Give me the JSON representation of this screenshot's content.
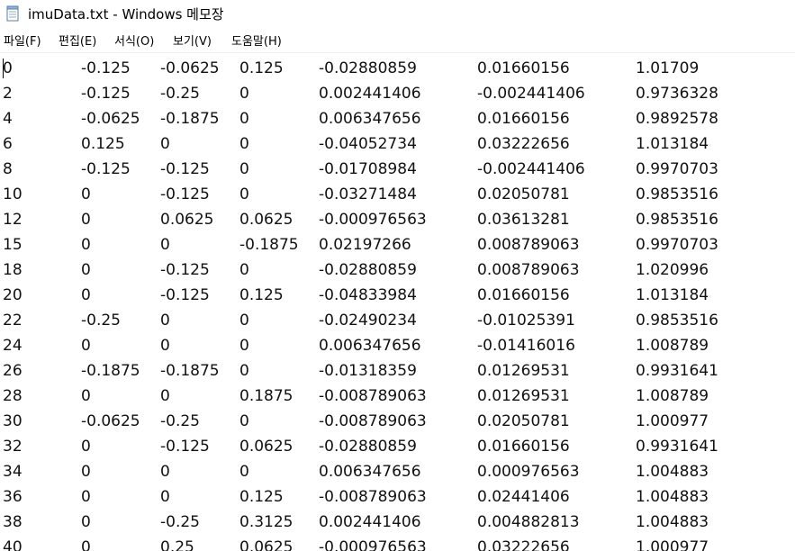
{
  "window": {
    "title": "imuData.txt - Windows 메모장",
    "icon": "notepad-icon"
  },
  "menu": {
    "items": [
      {
        "label": "파일(F)"
      },
      {
        "label": "편집(E)"
      },
      {
        "label": "서식(O)"
      },
      {
        "label": "보기(V)"
      },
      {
        "label": "도움말(H)"
      }
    ]
  },
  "document": {
    "rows": [
      [
        "0",
        "-0.125",
        "-0.0625",
        "0.125",
        "-0.02880859",
        "0.01660156",
        "1.01709"
      ],
      [
        "2",
        "-0.125",
        "-0.25",
        "0",
        "0.002441406",
        "-0.002441406",
        "0.9736328"
      ],
      [
        "4",
        "-0.0625",
        "-0.1875",
        "0",
        "0.006347656",
        "0.01660156",
        "0.9892578"
      ],
      [
        "6",
        "0.125",
        "0",
        "0",
        "-0.04052734",
        "0.03222656",
        "1.013184"
      ],
      [
        "8",
        "-0.125",
        "-0.125",
        "0",
        "-0.01708984",
        "-0.002441406",
        "0.9970703"
      ],
      [
        "10",
        "0",
        "-0.125",
        "0",
        "-0.03271484",
        "0.02050781",
        "0.9853516"
      ],
      [
        "12",
        "0",
        "0.0625",
        "0.0625",
        "-0.000976563",
        "0.03613281",
        "0.9853516"
      ],
      [
        "15",
        "0",
        "0",
        "-0.1875",
        "0.02197266",
        "0.008789063",
        "0.9970703"
      ],
      [
        "18",
        "0",
        "-0.125",
        "0",
        "-0.02880859",
        "0.008789063",
        "1.020996"
      ],
      [
        "20",
        "0",
        "-0.125",
        "0.125",
        "-0.04833984",
        "0.01660156",
        "1.013184"
      ],
      [
        "22",
        "-0.25",
        "0",
        "0",
        "-0.02490234",
        "-0.01025391",
        "0.9853516"
      ],
      [
        "24",
        "0",
        "0",
        "0",
        "0.006347656",
        "-0.01416016",
        "1.008789"
      ],
      [
        "26",
        "-0.1875",
        "-0.1875",
        "0",
        "-0.01318359",
        "0.01269531",
        "0.9931641"
      ],
      [
        "28",
        "0",
        "0",
        "0.1875",
        "-0.008789063",
        "0.01269531",
        "1.008789"
      ],
      [
        "30",
        "-0.0625",
        "-0.25",
        "0",
        "-0.008789063",
        "0.02050781",
        "1.000977"
      ],
      [
        "32",
        "0",
        "-0.125",
        "0.0625",
        "-0.02880859",
        "0.01660156",
        "0.9931641"
      ],
      [
        "34",
        "0",
        "0",
        "0",
        "0.006347656",
        "0.000976563",
        "1.004883"
      ],
      [
        "36",
        "0",
        "0",
        "0.125",
        "-0.008789063",
        "0.02441406",
        "1.004883"
      ],
      [
        "38",
        "0",
        "-0.25",
        "0.3125",
        "0.002441406",
        "0.004882813",
        "1.004883"
      ],
      [
        "40",
        "0",
        "0.25",
        "0.0625",
        "-0.000976563",
        "0.03222656",
        "1.000977"
      ]
    ]
  }
}
